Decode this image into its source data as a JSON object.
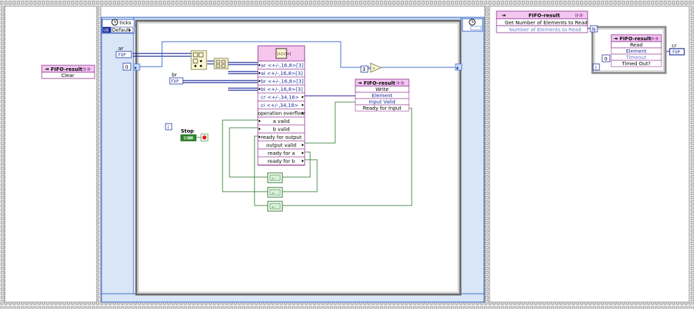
{
  "frame1": {
    "fifo_label": "FIFO-result",
    "method": "Clear"
  },
  "loop": {
    "ticks_label": "ticks",
    "ticks_type": "U8",
    "ticks_default": "Default",
    "ar_label": "ar",
    "br_label": "br",
    "fxp": "FXP",
    "zero_const": "0",
    "stop_label": "Stop",
    "tf_label": "TF",
    "iter_label": "i",
    "three_const": "3",
    "node_title": "[i]i[s]",
    "node_rows": [
      "ar <+/-,16,8>[3]",
      "ai <+/-,16,8>[3]",
      "br <+/-,16,8>[3]",
      "bi <+/-,16,8>[3]",
      "cr <+/-,34,18>",
      "ci <+/-,34,18>",
      "operation overflow",
      "a valid",
      "b valid",
      "ready for output",
      "output valid",
      "ready for a",
      "ready for b"
    ]
  },
  "write_node": {
    "fifo_label": "FIFO-result",
    "method": "Write",
    "rows": [
      "Element",
      "Input Valid",
      "Ready for Input"
    ]
  },
  "frame3": {
    "get_node": {
      "fifo_label": "FIFO-result",
      "method": "Get Number of Elements to Read",
      "row": "Number of Elements to Read"
    },
    "read_node": {
      "fifo_label": "FIFO-result",
      "method": "Read",
      "rows": [
        "Element",
        "Timeout",
        "Timed Out?"
      ]
    },
    "zero_const": "0",
    "iter_label": "i",
    "n_label": "N",
    "cr_label": "cr",
    "fxp": "FXP"
  }
}
